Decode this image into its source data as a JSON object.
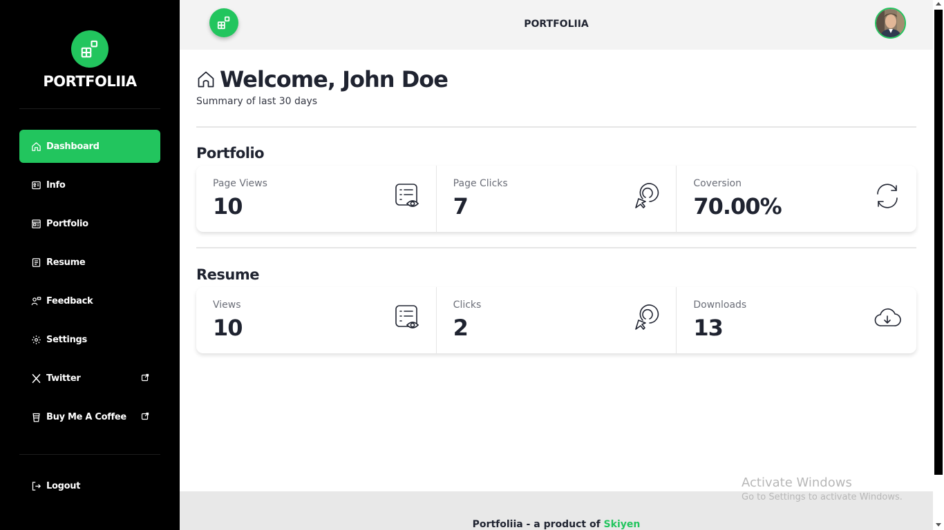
{
  "brand": {
    "name": "PORTFOLIIA",
    "accent": "#22c55e"
  },
  "sidebar": {
    "items": [
      {
        "label": "Dashboard",
        "icon": "home-icon"
      },
      {
        "label": "Info",
        "icon": "id-card-icon"
      },
      {
        "label": "Portfolio",
        "icon": "layout-icon"
      },
      {
        "label": "Resume",
        "icon": "document-icon"
      },
      {
        "label": "Feedback",
        "icon": "users-chat-icon"
      },
      {
        "label": "Settings",
        "icon": "gear-icon"
      },
      {
        "label": "Twitter",
        "icon": "x-logo-icon"
      },
      {
        "label": "Buy Me A Coffee",
        "icon": "coffee-cup-icon"
      },
      {
        "label": "Logout",
        "icon": "logout-icon"
      }
    ]
  },
  "topbar": {
    "title": "PORTFOLIIA"
  },
  "main": {
    "welcome": "Welcome, John Doe",
    "subtitle": "Summary of last 30 days",
    "portfolio": {
      "title": "Portfolio",
      "stats": [
        {
          "label": "Page Views",
          "value": "10",
          "icon": "list-eye-icon"
        },
        {
          "label": "Page Clicks",
          "value": "7",
          "icon": "cursor-click-icon"
        },
        {
          "label": "Coversion",
          "value": "70.00%",
          "icon": "refresh-icon"
        }
      ]
    },
    "resume": {
      "title": "Resume",
      "stats": [
        {
          "label": "Views",
          "value": "10",
          "icon": "list-eye-icon"
        },
        {
          "label": "Clicks",
          "value": "2",
          "icon": "cursor-click-icon"
        },
        {
          "label": "Downloads",
          "value": "13",
          "icon": "cloud-download-icon"
        }
      ]
    }
  },
  "footer": {
    "text": "Portfoliia - a product of ",
    "link": "Skiyen"
  },
  "watermark": {
    "title": "Activate Windows",
    "subtitle": "Go to Settings to activate Windows."
  }
}
